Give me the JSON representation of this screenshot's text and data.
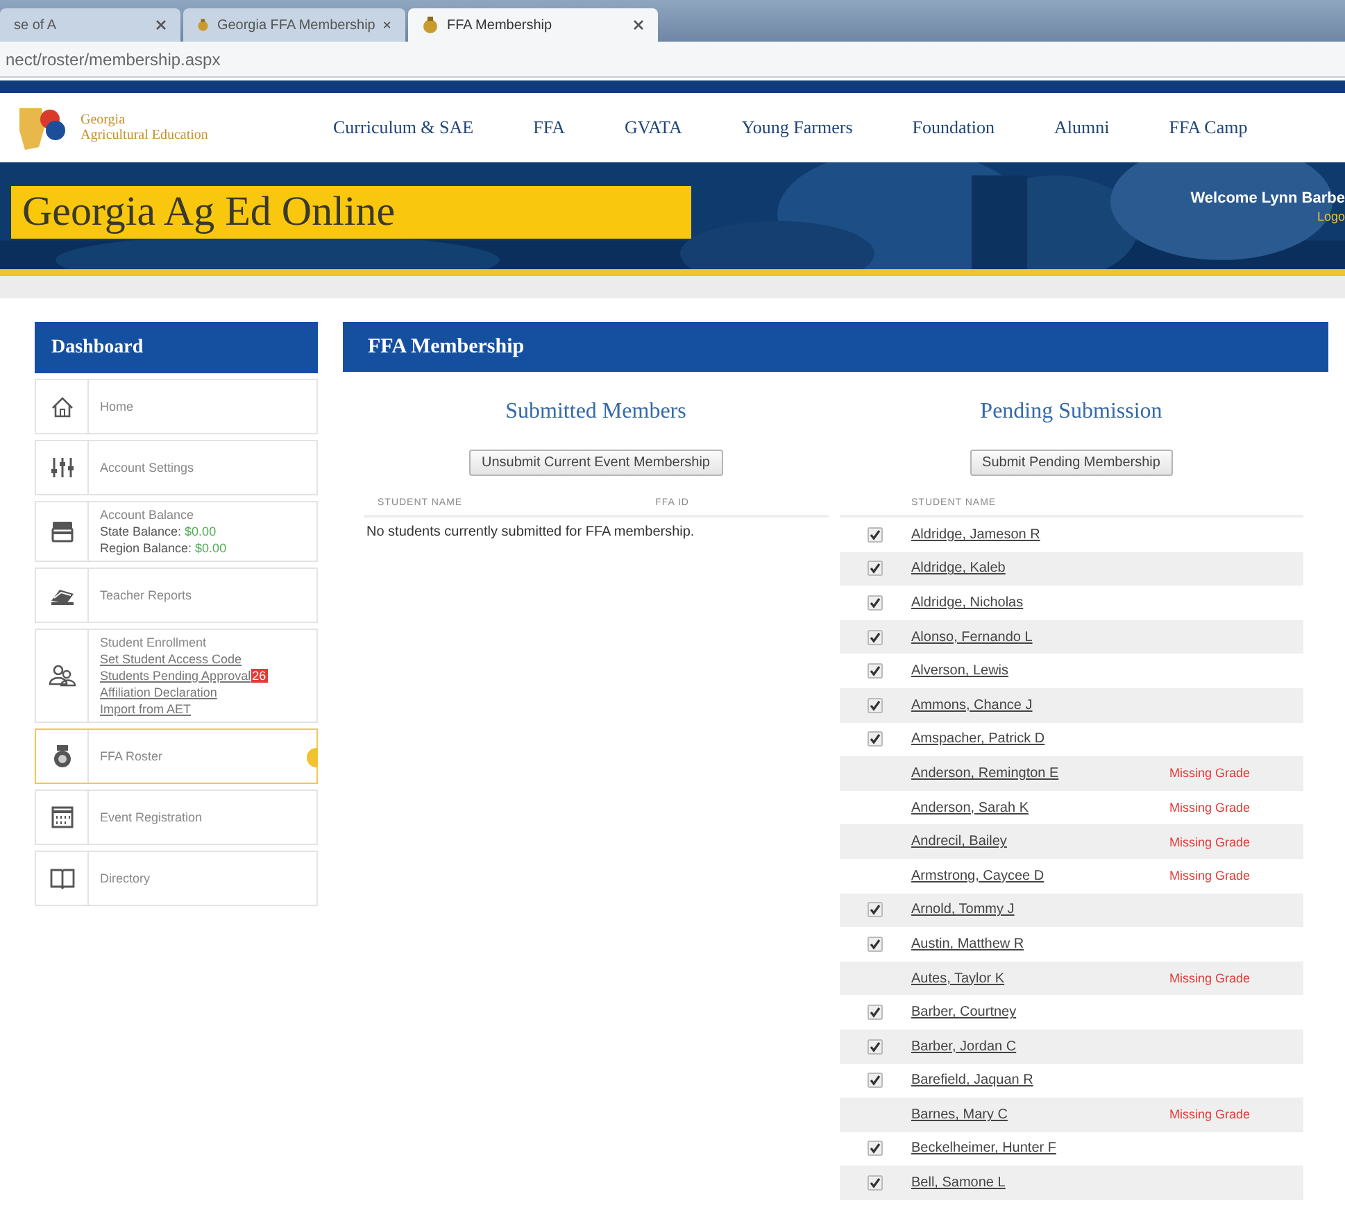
{
  "browser": {
    "tabs": [
      {
        "title": "se of A",
        "selected": false
      },
      {
        "title": "Georgia FFA Membership",
        "selected": false
      },
      {
        "title": "FFA Membership",
        "selected": true
      }
    ],
    "address": "nect/roster/membership.aspx"
  },
  "site": {
    "logo_line1": "Georgia",
    "logo_line2": "Agricultural Education",
    "nav": [
      "Curriculum & SAE",
      "FFA",
      "GVATA",
      "Young Farmers",
      "Foundation",
      "Alumni",
      "FFA Camp"
    ],
    "title": "Georgia Ag Ed Online",
    "welcome": "Welcome Lynn Barbe",
    "logout": "Logo"
  },
  "sidebar": {
    "title": "Dashboard",
    "items": [
      {
        "kind": "home",
        "label": "Home",
        "selected": false
      },
      {
        "kind": "settings",
        "label": "Account Settings",
        "selected": false
      },
      {
        "kind": "balance",
        "label": "Account Balance",
        "lines": [
          {
            "label": "State Balance:",
            "value": "$0.00"
          },
          {
            "label": "Region Balance:",
            "value": "$0.00"
          }
        ],
        "selected": false
      },
      {
        "kind": "reports",
        "label": "Teacher Reports",
        "selected": false
      },
      {
        "kind": "enrollment",
        "label": "Student Enrollment",
        "links": [
          {
            "text": "Set Student Access Code"
          },
          {
            "text": "Students Pending Approval",
            "badge": "26"
          },
          {
            "text": "Affiliation Declaration"
          },
          {
            "text": "Import from AET"
          }
        ],
        "selected": false
      },
      {
        "kind": "roster",
        "label": "FFA Roster",
        "selected": true
      },
      {
        "kind": "events",
        "label": "Event Registration",
        "selected": false
      },
      {
        "kind": "directory",
        "label": "Directory",
        "selected": false
      }
    ]
  },
  "panel": {
    "title": "FFA Membership",
    "submitted": {
      "heading": "Submitted Members",
      "button": "Unsubmit Current Event Membership",
      "columns": [
        "STUDENT NAME",
        "FFA ID"
      ],
      "empty": "No students currently submitted for FFA membership."
    },
    "pending": {
      "heading": "Pending Submission",
      "button": "Submit Pending Membership",
      "columns": [
        "STUDENT NAME"
      ],
      "rows": [
        {
          "name": "Aldridge, Jameson R",
          "checked": true
        },
        {
          "name": "Aldridge, Kaleb",
          "checked": true
        },
        {
          "name": "Aldridge, Nicholas",
          "checked": true
        },
        {
          "name": "Alonso, Fernando L",
          "checked": true
        },
        {
          "name": "Alverson, Lewis",
          "checked": true
        },
        {
          "name": "Ammons, Chance J",
          "checked": true
        },
        {
          "name": "Amspacher, Patrick D",
          "checked": true
        },
        {
          "name": "Anderson, Remington E",
          "checked": false,
          "note": "Missing Grade"
        },
        {
          "name": "Anderson, Sarah K",
          "checked": false,
          "note": "Missing Grade"
        },
        {
          "name": "Andrecil, Bailey",
          "checked": false,
          "note": "Missing Grade"
        },
        {
          "name": "Armstrong, Caycee D",
          "checked": false,
          "note": "Missing Grade"
        },
        {
          "name": "Arnold, Tommy J",
          "checked": true
        },
        {
          "name": "Austin, Matthew R",
          "checked": true
        },
        {
          "name": "Autes, Taylor K",
          "checked": false,
          "note": "Missing Grade"
        },
        {
          "name": "Barber, Courtney",
          "checked": true
        },
        {
          "name": "Barber, Jordan C",
          "checked": true
        },
        {
          "name": "Barefield, Jaquan R",
          "checked": true
        },
        {
          "name": "Barnes, Mary C",
          "checked": false,
          "note": "Missing Grade"
        },
        {
          "name": "Beckelheimer, Hunter F",
          "checked": true
        },
        {
          "name": "Bell, Samone L",
          "checked": true
        }
      ]
    }
  }
}
